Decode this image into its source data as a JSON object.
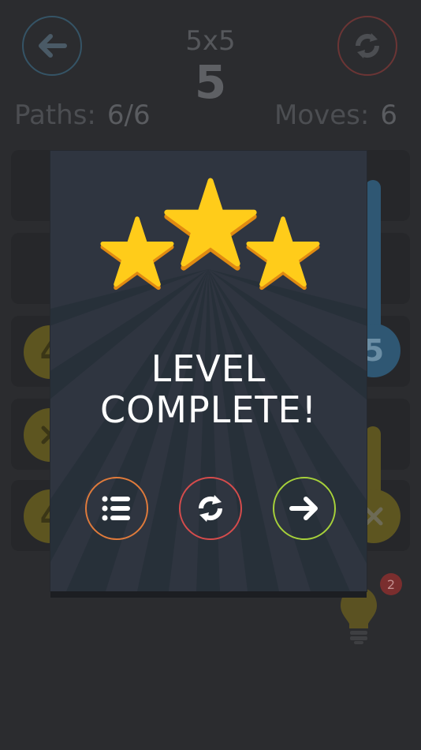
{
  "header": {
    "level_size": "5x5",
    "level_number": "5",
    "paths_label": "Paths:",
    "paths_value": "6/6",
    "moves_label": "Moves:",
    "moves_value": "6"
  },
  "board": {
    "visible_numbers": [
      "4",
      "4",
      "5"
    ],
    "colors": {
      "yellow": "#f2d02a",
      "blue": "#3a8fd1"
    }
  },
  "hint": {
    "count": "2",
    "icon": "lightbulb-icon"
  },
  "modal": {
    "stars_earned": 3,
    "stars_total": 3,
    "title_line1": "LEVEL",
    "title_line2": "COMPLETE!",
    "buttons": [
      {
        "name": "levels",
        "icon": "list-icon",
        "color": "#e07b3b"
      },
      {
        "name": "replay",
        "icon": "refresh-icon",
        "color": "#d64c4c"
      },
      {
        "name": "next",
        "icon": "arrow-right-icon",
        "color": "#a7d13a"
      }
    ]
  },
  "colors": {
    "star": "#ffcc1a",
    "modal_bg": "#2f3540",
    "page_bg": "#2b2c2f"
  }
}
